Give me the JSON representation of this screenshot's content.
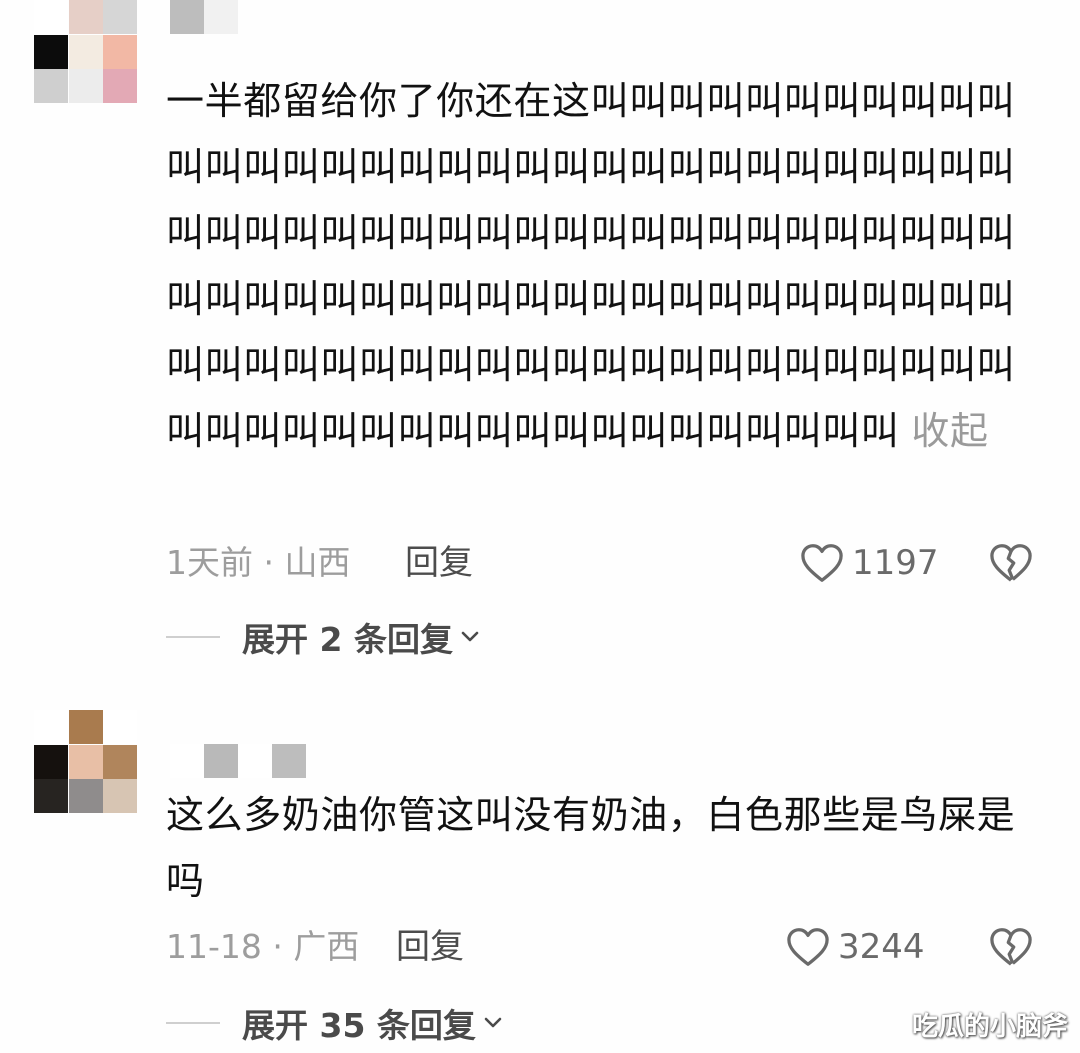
{
  "comments": [
    {
      "avatar_colors": [
        "#ffffff",
        "#e6cfc7",
        "#d6d6d6",
        "#0c0c0c",
        "#f3ebe1",
        "#f2b8a5",
        "#cfcfcf",
        "#ececec",
        "#e3a9b5"
      ],
      "username_blocks": [
        "#bdbdbd",
        "#f1f1f1"
      ],
      "text": "一半都留给你了你还在这叫叫叫叫叫叫叫叫叫叫叫叫叫叫叫叫叫叫叫叫叫叫叫叫叫叫叫叫叫叫叫叫叫叫叫叫叫叫叫叫叫叫叫叫叫叫叫叫叫叫叫叫叫叫叫叫叫叫叫叫叫叫叫叫叫叫叫叫叫叫叫叫叫叫叫叫叫叫叫叫叫叫叫叫叫叫叫叫叫叫叫叫叫叫叫叫叫叫叫叫叫叫叫叫叫叫叫叫叫叫叫叫叫叫叫叫叫叫",
      "collapse_label": "收起",
      "meta": "1天前 · 山西",
      "reply_label": "回复",
      "like_count": "1197",
      "expand_label": "展开 2 条回复"
    },
    {
      "avatar_colors": [
        "#ffffff",
        "#a97b4e",
        "#ffffff",
        "#15110e",
        "#e8bfa6",
        "#b0855c",
        "#272421",
        "#8f8c8c",
        "#d7c5b3"
      ],
      "username_blocks": [
        "#ffffff",
        "#b9b9b9",
        "#ffffff",
        "#bdbdbd"
      ],
      "text": "这么多奶油你管这叫没有奶油，白色那些是鸟屎是吗",
      "meta": "11-18 · 广西",
      "reply_label": "回复",
      "like_count": "3244",
      "expand_label": "展开 35 条回复"
    }
  ],
  "watermark": "吃瓜的小脑斧",
  "icons": {
    "like": "heart-outline-icon",
    "dislike": "broken-heart-icon",
    "expand": "chevron-down-icon"
  }
}
